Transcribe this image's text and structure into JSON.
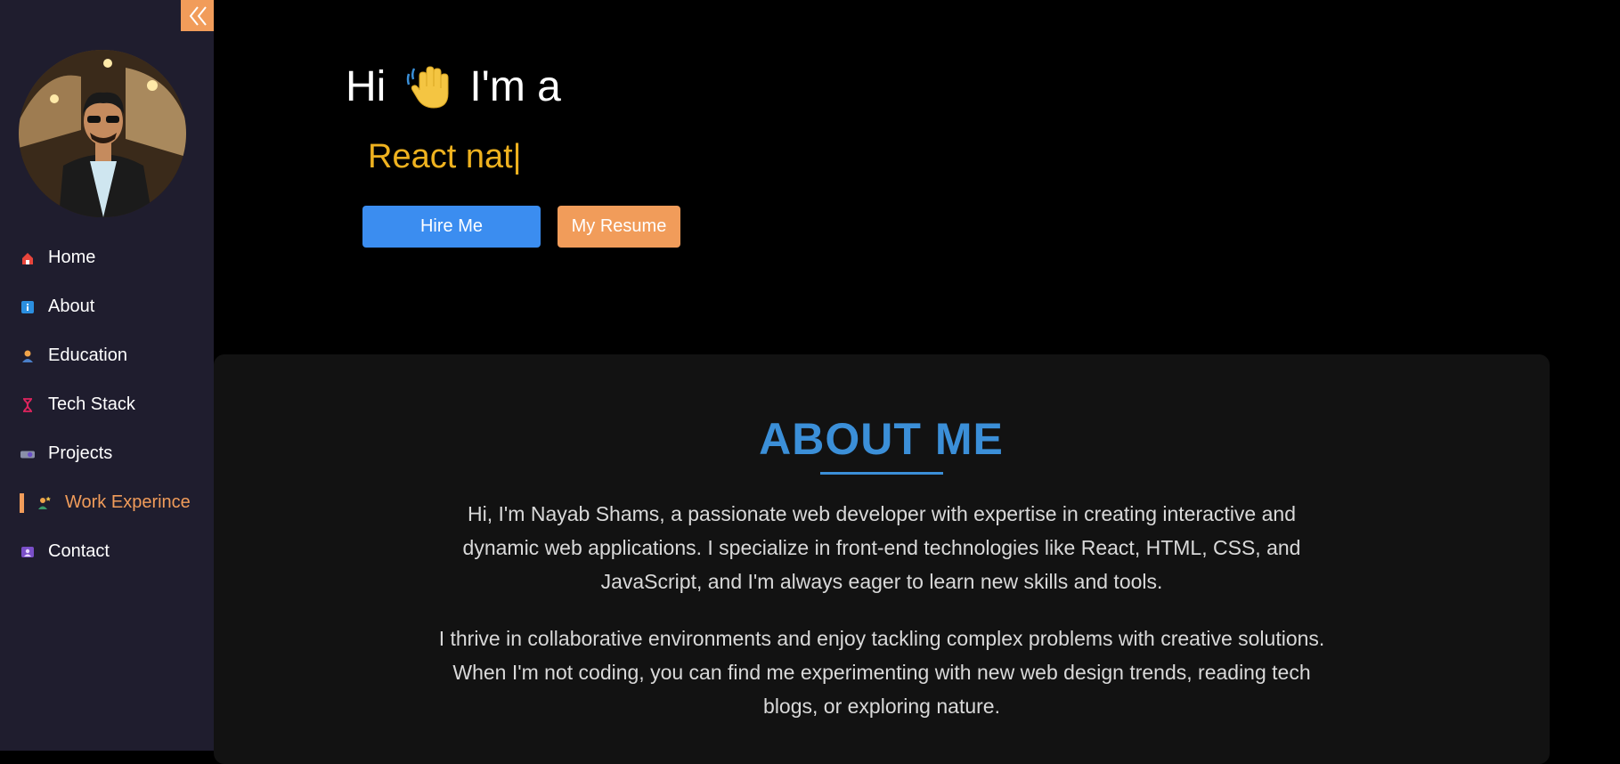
{
  "sidebar": {
    "collapse_icon": "double-chevron-left-icon",
    "avatar_alt": "profile photo",
    "items": [
      {
        "label": "Home",
        "icon": "house-icon",
        "color": "#e8453c"
      },
      {
        "label": "About",
        "icon": "info-icon",
        "color": "#2b8fe0"
      },
      {
        "label": "Education",
        "icon": "student-icon",
        "color": "#f0a44a"
      },
      {
        "label": "Tech Stack",
        "icon": "dna-icon",
        "color": "#e0245e"
      },
      {
        "label": "Projects",
        "icon": "projector-icon",
        "color": "#8a7fd8"
      },
      {
        "label": "Work Experince",
        "icon": "worker-icon",
        "color": "#f0c24a",
        "active": true
      },
      {
        "label": "Contact",
        "icon": "contact-card-icon",
        "color": "#7a4fc8"
      }
    ]
  },
  "hero": {
    "greeting_pre": "Hi",
    "greeting_post": "I'm a",
    "wave_icon": "waving-hand-icon",
    "typed_text": "React nat|",
    "hire_label": "Hire Me",
    "resume_label": "My Resume"
  },
  "about": {
    "title": "ABOUT ME",
    "paragraph1": "Hi, I'm Nayab Shams, a passionate web developer with expertise in creating interactive and dynamic web applications. I specialize in front-end technologies like React, HTML, CSS, and JavaScript, and I'm always eager to learn new skills and tools.",
    "paragraph2": "I thrive in collaborative environments and enjoy tackling complex problems with creative solutions. When I'm not coding, you can find me experimenting with new web design trends, reading tech blogs, or exploring nature."
  },
  "colors": {
    "accent": "#f19c5a",
    "primary": "#3b8df0",
    "highlight": "#efb21f",
    "heading": "#3b8fd8",
    "sidebar_bg": "#1f1d2e"
  }
}
